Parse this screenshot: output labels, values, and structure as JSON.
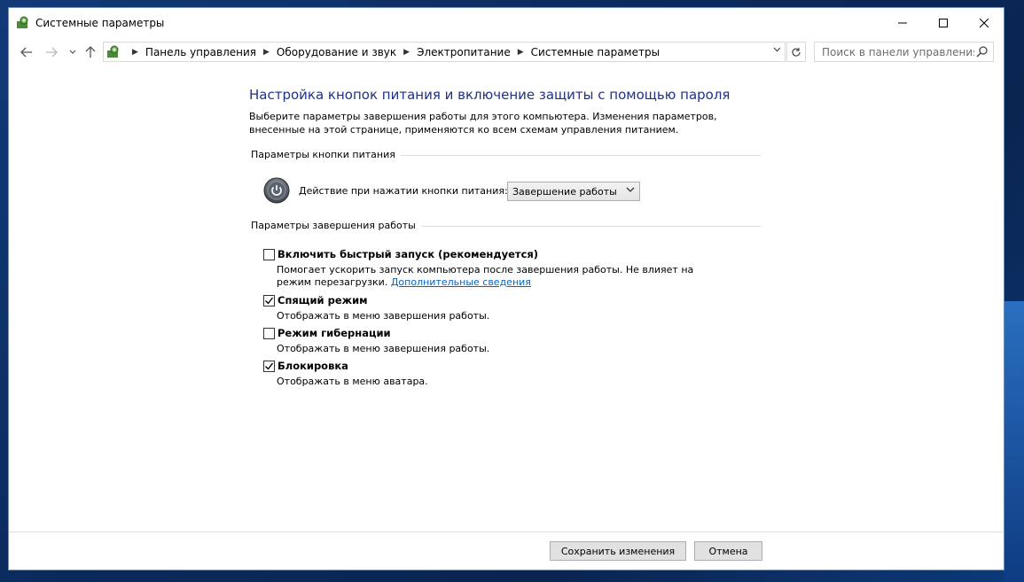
{
  "window": {
    "title": "Системные параметры"
  },
  "address": {
    "breadcrumbs": [
      "Панель управления",
      "Оборудование и звук",
      "Электропитание",
      "Системные параметры"
    ],
    "search_placeholder": "Поиск в панели управления"
  },
  "page": {
    "heading": "Настройка кнопок питания и включение защиты с помощью пароля",
    "description": "Выберите параметры завершения работы для этого компьютера. Изменения параметров, внесенные на этой странице, применяются ко всем схемам управления питанием."
  },
  "power_button": {
    "group_label": "Параметры кнопки питания",
    "action_label": "Действие при нажатии кнопки питания:",
    "selected_value": "Завершение работы"
  },
  "shutdown": {
    "group_label": "Параметры завершения работы",
    "options": [
      {
        "label": "Включить быстрый запуск (рекомендуется)",
        "checked": false,
        "desc": "Помогает ускорить запуск компьютера после завершения работы. Не влияет на режим перезагрузки.",
        "link": "Дополнительные сведения"
      },
      {
        "label": "Спящий режим",
        "checked": true,
        "desc": "Отображать в меню завершения работы."
      },
      {
        "label": "Режим гибернации",
        "checked": false,
        "desc": "Отображать в меню завершения работы."
      },
      {
        "label": "Блокировка",
        "checked": true,
        "desc": "Отображать в меню аватара."
      }
    ]
  },
  "footer": {
    "save_label": "Сохранить изменения",
    "cancel_label": "Отмена"
  }
}
